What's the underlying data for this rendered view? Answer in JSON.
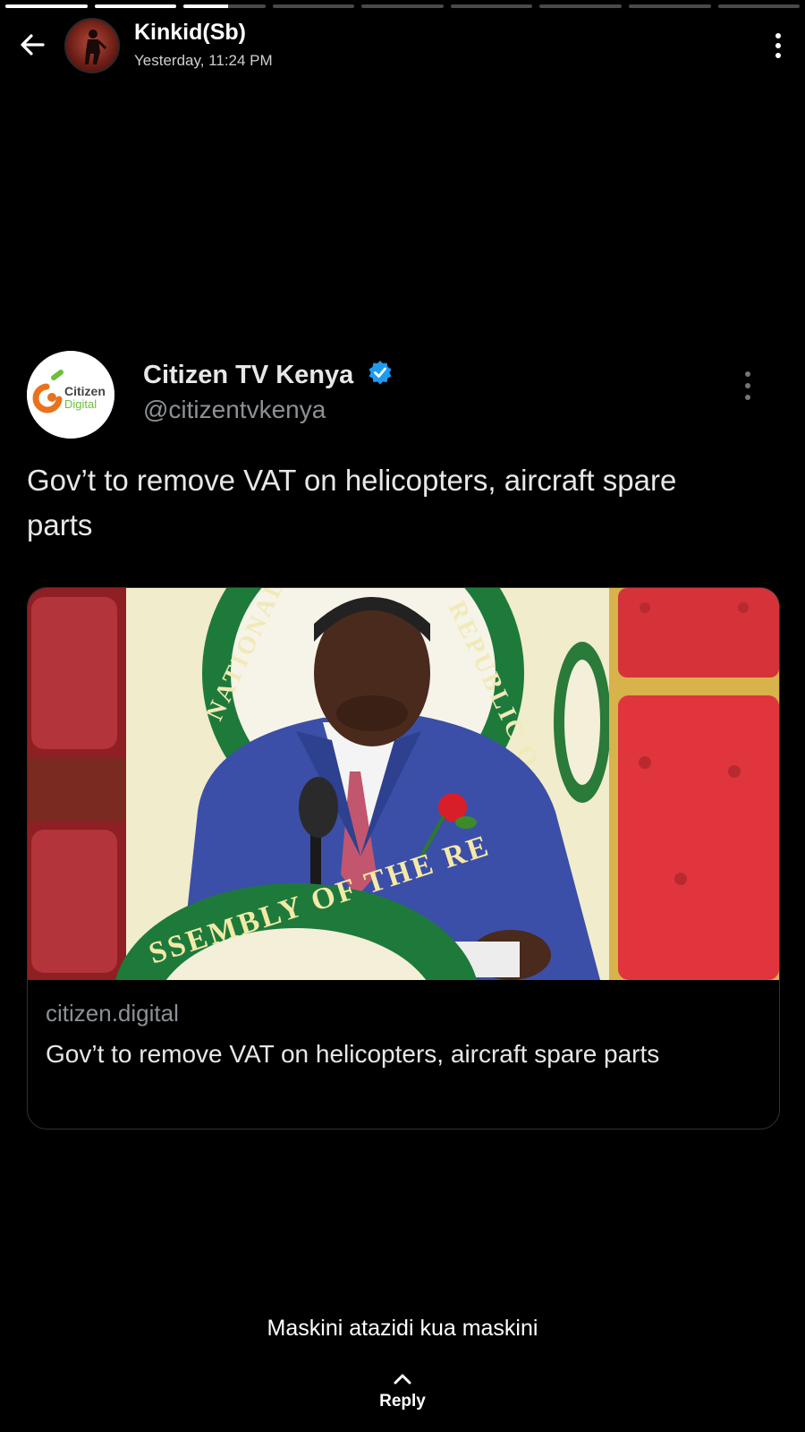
{
  "story": {
    "segments": [
      1,
      1,
      0.55,
      0,
      0,
      0,
      0,
      0,
      0
    ],
    "user_name": "Kinkid(Sb)",
    "timestamp": "Yesterday, 11:24 PM"
  },
  "tweet": {
    "display_name": "Citizen TV Kenya",
    "handle": "@citizentvkenya",
    "text": "Gov’t to remove VAT on helicopters, aircraft spare parts",
    "logo_text_1": "Citizen",
    "logo_text_2": "Digital",
    "card": {
      "seal_text": "SSEMBLY OF THE RE",
      "seal_top_left": "NATIONAL A",
      "seal_top_right": "REPUBLIC O",
      "domain": "citizen.digital",
      "title": "Gov’t to remove VAT on helicopters, aircraft spare parts"
    }
  },
  "caption": "Maskini atazidi kua maskini",
  "reply_label": "Reply",
  "colors": {
    "background": "#000000",
    "verified": "#1d9bf0",
    "muted_text": "#8b9196"
  }
}
